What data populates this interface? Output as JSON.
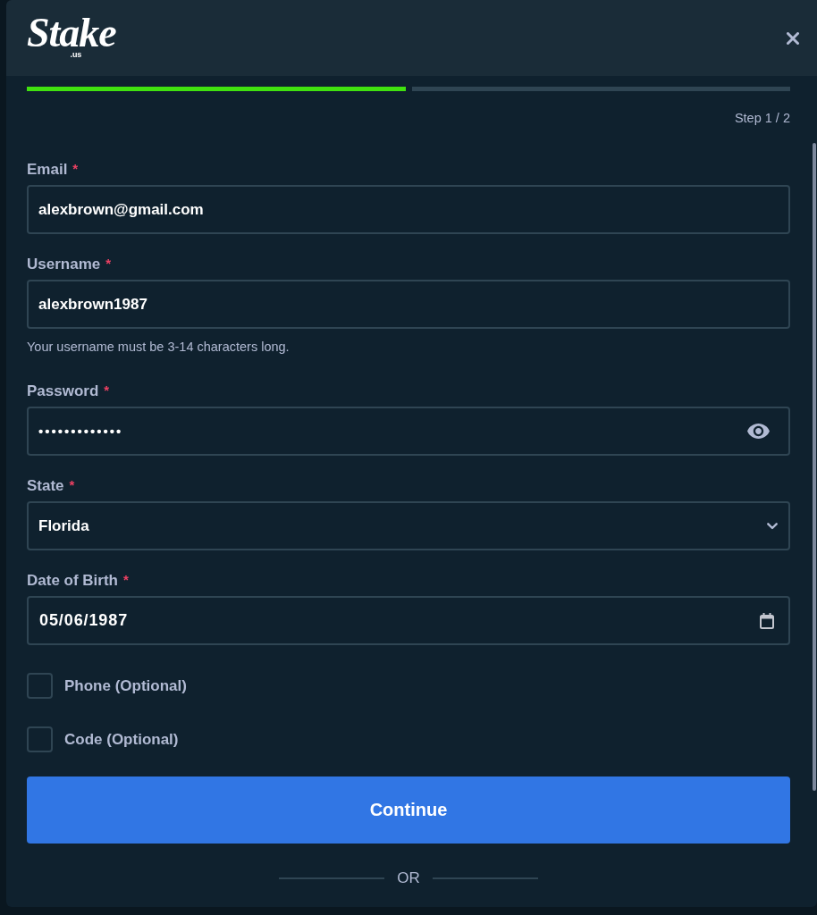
{
  "header": {
    "logo": {
      "wordmark": "Stake",
      "suffix": ".us"
    }
  },
  "progress": {
    "level": 0.5,
    "step_label": "Step 1 / 2"
  },
  "fields": [
    {
      "kind": "text",
      "label": "Email",
      "required_mark": "*",
      "value": "alexbrown@gmail.com"
    },
    {
      "kind": "text",
      "label": "Username",
      "required_mark": "*",
      "value": "alexbrown1987",
      "hint": "Your username must be 3-14 characters long."
    },
    {
      "kind": "password",
      "label": "Password",
      "required_mark": "*",
      "value": "•••••••••••••"
    },
    {
      "kind": "select",
      "label": "State",
      "required_mark": "*",
      "value": "Florida"
    },
    {
      "kind": "date",
      "label": "Date of Birth",
      "required_mark": "*",
      "value": "05/06/1987"
    }
  ],
  "options": [
    {
      "label": "Phone (Optional)",
      "checked": false
    },
    {
      "label": "Code (Optional)",
      "checked": false
    }
  ],
  "submit": {
    "label": "Continue"
  },
  "divider": {
    "label": "OR"
  }
}
